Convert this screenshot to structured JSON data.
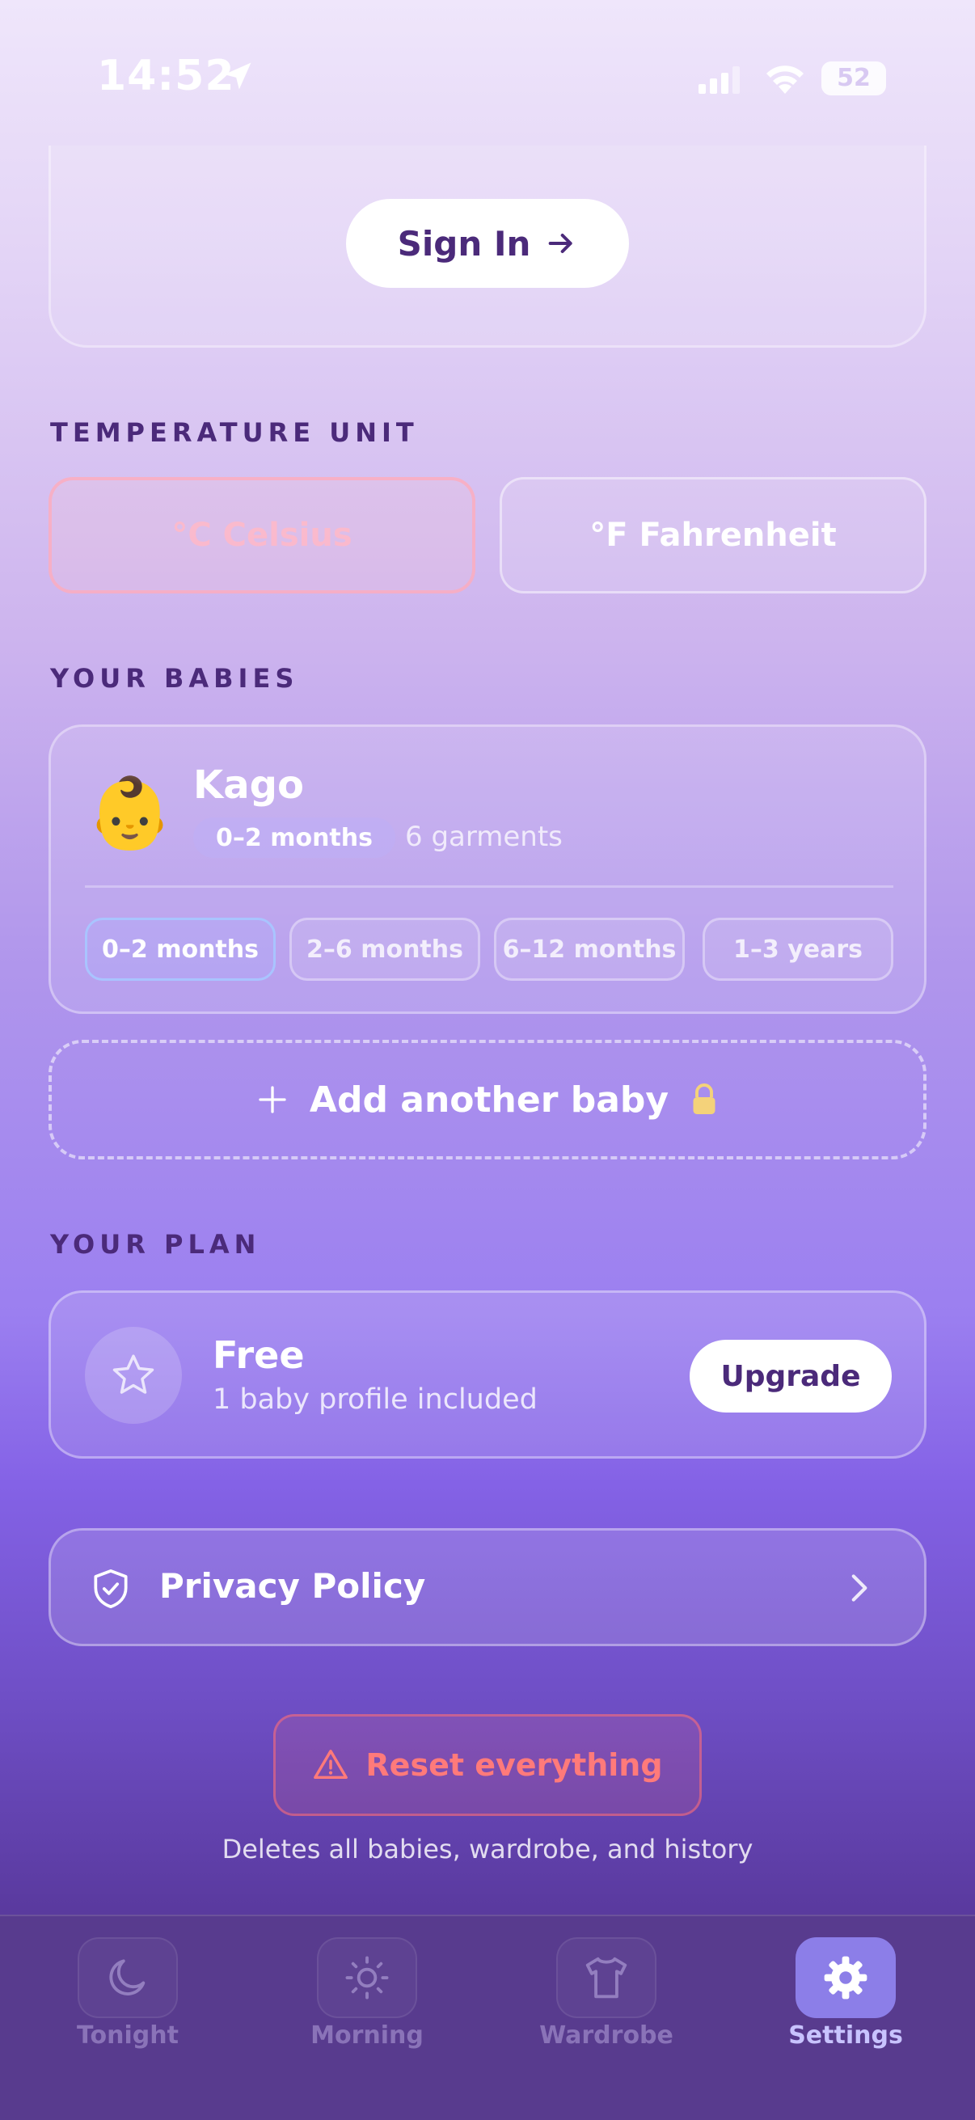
{
  "status_bar": {
    "time": "14:52",
    "battery": "52"
  },
  "account": {
    "sign_in_label": "Sign In"
  },
  "temperature": {
    "section_label": "TEMPERATURE UNIT",
    "celsius_label": "°C Celsius",
    "fahrenheit_label": "°F Fahrenheit"
  },
  "babies": {
    "section_label": "YOUR BABIES",
    "items": [
      {
        "name": "Kago",
        "emoji": "👶",
        "age": "0–2 months",
        "garments": "6 garments",
        "age_options": [
          "0–2 months",
          "2–6 months",
          "6–12 months",
          "1–3 years"
        ],
        "selected_age": "0–2 months"
      }
    ],
    "add_label": "Add another baby"
  },
  "plan": {
    "section_label": "YOUR PLAN",
    "name": "Free",
    "description": "1 baby profile included",
    "upgrade_label": "Upgrade"
  },
  "privacy": {
    "label": "Privacy Policy"
  },
  "reset": {
    "label": "Reset everything",
    "caption": "Deletes all babies, wardrobe, and history"
  },
  "tabs": [
    {
      "label": "Tonight",
      "icon": "moon-icon",
      "active": false
    },
    {
      "label": "Morning",
      "icon": "sun-icon",
      "active": false
    },
    {
      "label": "Wardrobe",
      "icon": "shirt-icon",
      "active": false
    },
    {
      "label": "Settings",
      "icon": "gear-icon",
      "active": true
    }
  ],
  "colors": {
    "accent": "#4b2a7a",
    "danger": "#ff7a7a",
    "active_tab": "#8c7ee8"
  }
}
